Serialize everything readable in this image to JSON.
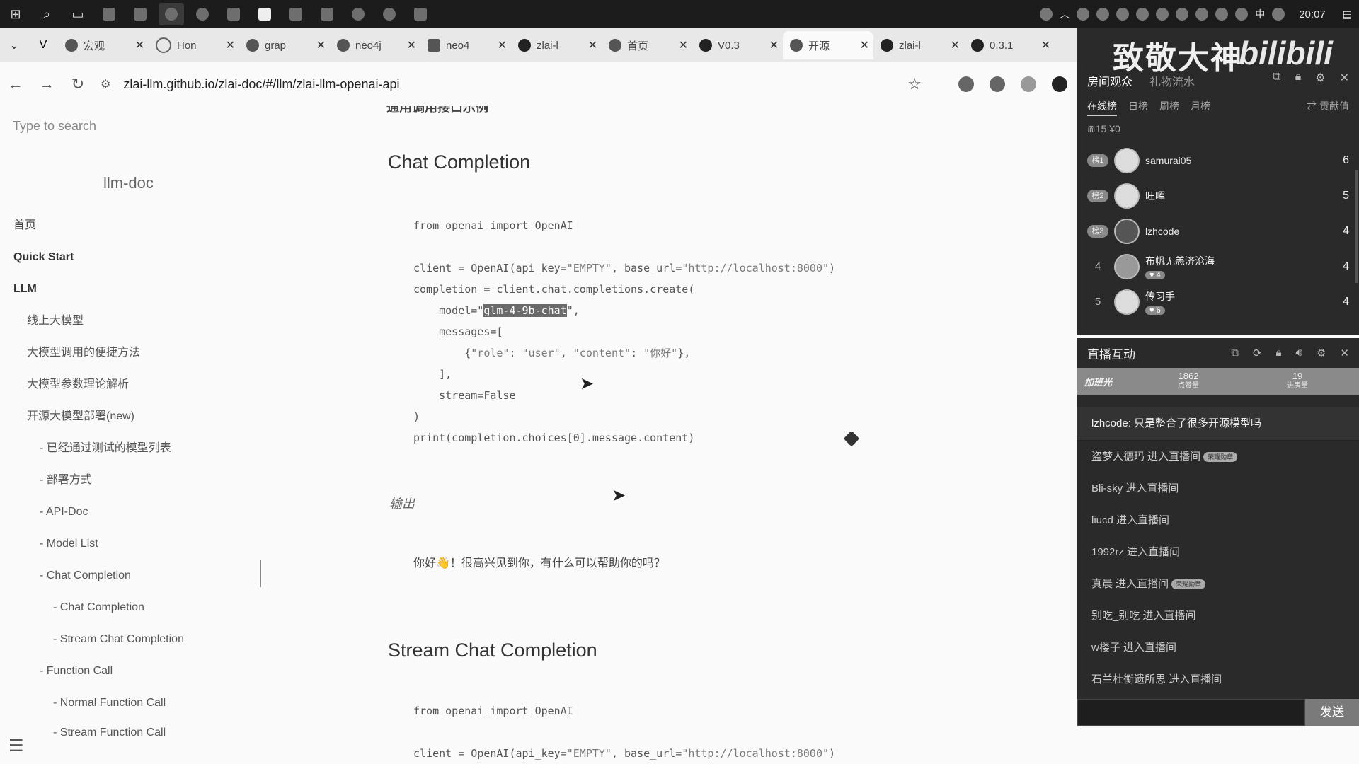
{
  "taskbar": {
    "clock": "20:07",
    "ime": "中"
  },
  "browser": {
    "tabs": [
      {
        "label": "宏观"
      },
      {
        "label": "Hon"
      },
      {
        "label": "grap"
      },
      {
        "label": "neo4j"
      },
      {
        "label": "neo4"
      },
      {
        "label": "zlai-l"
      },
      {
        "label": "首页"
      },
      {
        "label": "V0.3"
      },
      {
        "label": "开源"
      },
      {
        "label": "zlai-l"
      },
      {
        "label": "0.3.1"
      }
    ],
    "url": "zlai-llm.github.io/zlai-doc/#/llm/zlai-llm-openai-api"
  },
  "sidebar": {
    "search_placeholder": "Type to search",
    "brand": "llm-doc",
    "items": [
      {
        "label": "首页"
      },
      {
        "label": "Quick Start"
      },
      {
        "label": "LLM"
      },
      {
        "label": "线上大模型"
      },
      {
        "label": "大模型调用的便捷方法"
      },
      {
        "label": "大模型参数理论解析"
      },
      {
        "label": "开源大模型部署(new)"
      },
      {
        "label": "- 已经通过测试的模型列表"
      },
      {
        "label": "- 部署方式"
      },
      {
        "label": "- API-Doc"
      },
      {
        "label": "- Model List"
      },
      {
        "label": "- Chat Completion"
      },
      {
        "label": "- Chat Completion"
      },
      {
        "label": "- Stream Chat Completion"
      },
      {
        "label": "- Function Call"
      },
      {
        "label": "- Normal Function Call"
      },
      {
        "label": "- Stream Function Call"
      }
    ]
  },
  "content": {
    "cut_heading": "通用调用接口示例",
    "h_chat": "Chat Completion",
    "code1": {
      "l1": "from openai import OpenAI",
      "l2a": "client = OpenAI(api_key=",
      "l2b": "\"EMPTY\"",
      "l2c": ", base_url=",
      "l2d": "\"http://localhost:8000\"",
      "l2e": ")",
      "l3": "completion = client.chat.completions.create(",
      "l4a": "    model=\"",
      "l4b": "glm-4-9b-chat",
      "l4c": "\",",
      "l5": "    messages=[",
      "l6a": "        {",
      "l6b": "\"role\"",
      "l6c": ": ",
      "l6d": "\"user\"",
      "l6e": ", ",
      "l6f": "\"content\"",
      "l6g": ": ",
      "l6h": "\"你好\"",
      "l6i": "},",
      "l7": "    ],",
      "l8": "    stream=False",
      "l9": ")",
      "l10": "print(completion.choices[0].message.content)"
    },
    "output_label": "输出",
    "output_text": "你好👋！很高兴见到你，有什么可以帮助你的吗？",
    "h_stream": "Stream Chat Completion",
    "code2": {
      "l1": "from openai import OpenAI",
      "l2a": "client = OpenAI(api_key=",
      "l2b": "\"EMPTY\"",
      "l2c": ", base_url=",
      "l2d": "\"http://localhost:8000\"",
      "l2e": ")"
    }
  },
  "bili": {
    "overlay_text": "致敬大神",
    "logo": "bilibili",
    "tab_viewers": "房间观众",
    "tab_gifts": "礼物流水",
    "sub_online": "在线榜",
    "sub_day": "日榜",
    "sub_week": "周榜",
    "sub_month": "月榜",
    "contrib": "⇄ 贡献值",
    "counts": "⋒15  ¥0",
    "viewers": [
      {
        "rank": "榜1",
        "name": "samurai05",
        "score": "6",
        "badge": ""
      },
      {
        "rank": "榜2",
        "name": "旺晖",
        "score": "5",
        "badge": ""
      },
      {
        "rank": "榜3",
        "name": "lzhcode",
        "score": "4",
        "badge": ""
      },
      {
        "rank": "4",
        "name": "布帆无恙济沧海",
        "score": "4",
        "badge": "♥ 4"
      },
      {
        "rank": "5",
        "name": "传习手",
        "score": "4",
        "badge": "♥ 6"
      }
    ],
    "chat_title": "直播互动",
    "stats": {
      "left": "加班光",
      "likes_value": "1862",
      "likes_label": "点赞量",
      "entries_value": "19",
      "entries_label": "进房量"
    },
    "messages": [
      {
        "text": "lzhcode: 只是整合了很多开源模型吗",
        "badge": ""
      },
      {
        "text": "盗梦人德玛 进入直播间",
        "badge": "荣耀勋章"
      },
      {
        "text": "Bli-sky 进入直播间",
        "badge": ""
      },
      {
        "text": "liucd 进入直播间",
        "badge": ""
      },
      {
        "text": "1992rz 进入直播间",
        "badge": ""
      },
      {
        "text": "真晨 进入直播间",
        "badge": "荣耀勋章"
      },
      {
        "text": "别吃_别吃 进入直播间",
        "badge": ""
      },
      {
        "text": "w楼子 进入直播间",
        "badge": ""
      },
      {
        "text": "石兰杜衡遗所思 进入直播间",
        "badge": ""
      }
    ],
    "send_label": "发送"
  }
}
